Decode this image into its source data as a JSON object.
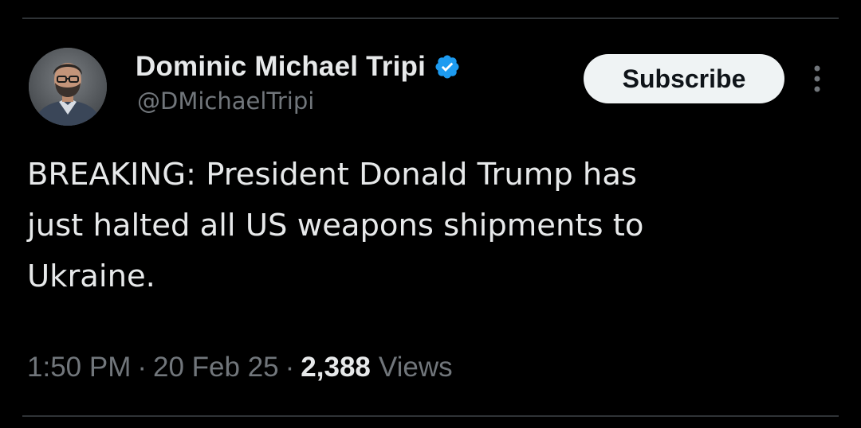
{
  "author": {
    "display_name": "Dominic Michael Tripi",
    "handle": "@DMichaelTripi",
    "verified": true,
    "avatar_icon": "profile-photo"
  },
  "actions": {
    "subscribe_label": "Subscribe",
    "more_icon": "more-vertical-icon"
  },
  "tweet": {
    "text": "BREAKING: President Donald Trump has\njust halted all US weapons shipments to\nUkraine.",
    "time": "1:50 PM",
    "separator": "·",
    "date": "20 Feb 25",
    "views_count": "2,388",
    "views_label": "Views"
  },
  "colors": {
    "background": "#000000",
    "primary_text": "#e7e9ea",
    "secondary_text": "#71767b",
    "verified_badge": "#1d9bf0",
    "button_bg": "#eff3f4",
    "divider": "#2f3336"
  }
}
